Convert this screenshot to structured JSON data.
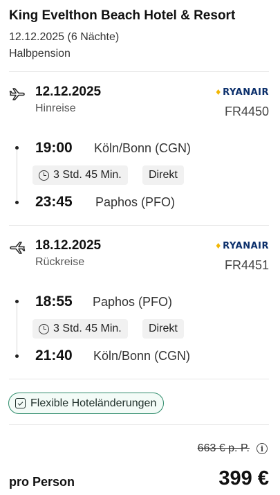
{
  "hotel": {
    "title": "King Evelthon Beach Hotel & Resort",
    "dates": "12.12.2025 (6 Nächte)",
    "board": "Halbpension"
  },
  "flights": [
    {
      "icon": "plane-departure-icon",
      "date": "12.12.2025",
      "direction": "Hinreise",
      "airline": "RYANAIR",
      "flight_number": "FR4450",
      "departure_time": "19:00",
      "departure_airport": "Köln/Bonn (CGN)",
      "duration": "3 Std. 45 Min.",
      "stops": "Direkt",
      "arrival_time": "23:45",
      "arrival_airport": "Paphos (PFO)"
    },
    {
      "icon": "plane-arrival-icon",
      "date": "18.12.2025",
      "direction": "Rückreise",
      "airline": "RYANAIR",
      "flight_number": "FR4451",
      "departure_time": "18:55",
      "departure_airport": "Paphos (PFO)",
      "duration": "3 Std. 45 Min.",
      "stops": "Direkt",
      "arrival_time": "21:40",
      "arrival_airport": "Köln/Bonn (CGN)"
    }
  ],
  "badges": {
    "flexible": "Flexible Hoteländerungen"
  },
  "pricing": {
    "old_price": "663 € p. P.",
    "per_person_label": "pro Person",
    "price": "399 €"
  },
  "colors": {
    "airline_blue": "#0b2f6b",
    "airline_yellow": "#f2b705",
    "badge_border": "#2e8b6b",
    "chip_bg": "#f1f1f1"
  }
}
